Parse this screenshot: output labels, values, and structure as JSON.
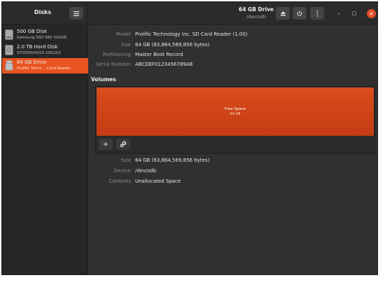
{
  "sidebar": {
    "title": "Disks",
    "menu_icon": "hamburger-menu-icon",
    "devices": [
      {
        "name": "500 GB Disk",
        "subtitle": "Samsung SSD 980 500GB",
        "icon": "drive-icon",
        "selected": false
      },
      {
        "name": "2.0 TB Hard Disk",
        "subtitle": "ST2000VX015-2XG102",
        "icon": "drive-icon",
        "selected": false
      },
      {
        "name": "64 GB Drive",
        "subtitle": "Prolific Techn... Card Reader",
        "icon": "usb-drive-icon",
        "selected": true
      }
    ]
  },
  "header": {
    "title": "64 GB Drive",
    "subtitle": "/dev/sdb",
    "eject_icon": "eject-icon",
    "power_icon": "power-icon",
    "menu_icon": "kebab-menu-icon",
    "window": {
      "minimize": "–",
      "maximize": "□",
      "close": "×"
    }
  },
  "drive_info": [
    {
      "label": "Model",
      "value": "Prolific Technology Inc. SD Card Reader (1.00)"
    },
    {
      "label": "Size",
      "value": "64 GB (63,864,569,856 bytes)"
    },
    {
      "label": "Partitioning",
      "value": "Master Boot Record"
    },
    {
      "label": "Serial Number",
      "value": "ABCDEF0123456789AB"
    }
  ],
  "volumes": {
    "heading": "Volumes",
    "partition": {
      "name": "Free Space",
      "size": "64 GB"
    },
    "toolbar": {
      "add": "+",
      "settings_icon": "gears-icon"
    }
  },
  "volume_info": [
    {
      "label": "Size",
      "value": "64 GB (63,864,569,856 bytes)"
    },
    {
      "label": "Device",
      "value": "/dev/sdb"
    },
    {
      "label": "Contents",
      "value": "Unallocated Space"
    }
  ],
  "colors": {
    "accent": "#e95420",
    "background": "#303030",
    "sidebar": "#262626"
  }
}
